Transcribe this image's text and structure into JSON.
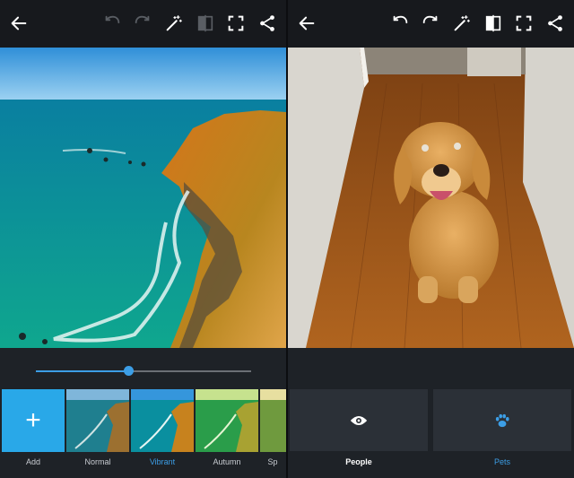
{
  "left_screen": {
    "toolbar": {
      "icons": [
        "back-arrow-icon",
        "undo-icon",
        "redo-icon",
        "magic-wand-icon",
        "compare-icon",
        "crop-icon",
        "share-icon"
      ],
      "undo_enabled": false,
      "redo_enabled": false
    },
    "slider": {
      "value": 0.43,
      "accent": "#3c9ee6"
    },
    "filters": [
      {
        "label": "Add",
        "icon": "plus-icon",
        "active": false
      },
      {
        "label": "Normal",
        "active": false
      },
      {
        "label": "Vibrant",
        "active": true
      },
      {
        "label": "Autumn",
        "active": false
      },
      {
        "label": "Sp",
        "active": false
      }
    ]
  },
  "right_screen": {
    "toolbar": {
      "icons": [
        "back-arrow-icon",
        "undo-icon",
        "redo-icon",
        "magic-wand-icon",
        "compare-icon",
        "crop-icon",
        "share-icon"
      ],
      "undo_enabled": true,
      "redo_enabled": true
    },
    "categories": [
      {
        "label": "People",
        "icon": "eye-icon",
        "selected": true
      },
      {
        "label": "Pets",
        "icon": "paw-icon",
        "selected": false
      }
    ]
  },
  "colors": {
    "accent": "#3c9ee6",
    "add_tile": "#29a8e8",
    "toolbar_bg": "#17191d",
    "panel_bg": "#1e2227"
  }
}
